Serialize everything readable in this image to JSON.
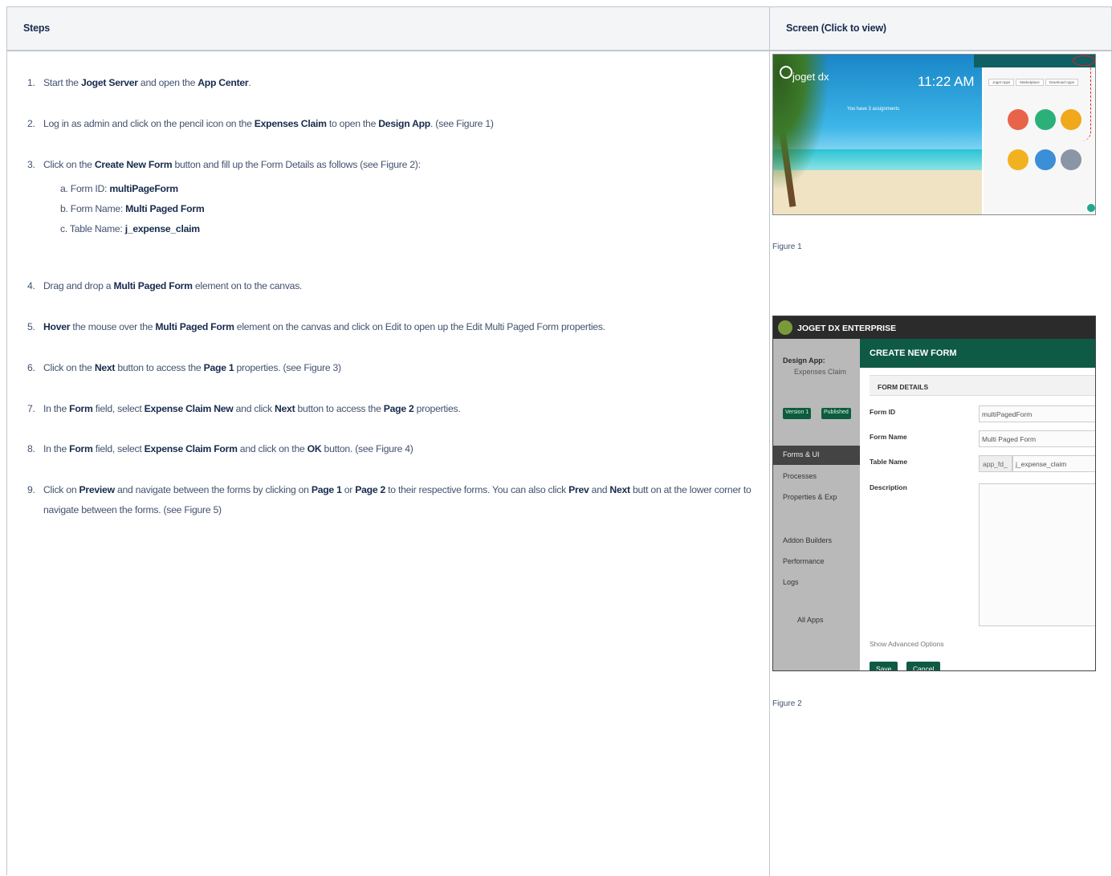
{
  "header": {
    "steps": "Steps",
    "screen": "Screen (Click to view)"
  },
  "steps": [
    {
      "num": "1.",
      "parts": [
        "Start the ",
        "Joget Server",
        " and open the ",
        "App Center",
        "."
      ]
    },
    {
      "num": "2.",
      "parts": [
        "Log in as admin and click on the pencil icon on the ",
        "Expenses Claim",
        " to open the ",
        "Design App",
        ". (see Figure 1)"
      ]
    },
    {
      "num": "3.",
      "parts": [
        "Click on the ",
        "Create New Form",
        " button and fill up the Form Details as follows (see Figure 2):"
      ]
    },
    {
      "num": "4.",
      "parts": [
        "Drag and drop a ",
        "Multi Paged Form",
        " element on to the canvas."
      ]
    },
    {
      "num": "5.",
      "parts": [
        "",
        "Hover",
        " the mouse over the ",
        "Multi Paged Form",
        " element on the canvas and click on Edit to open up the Edit Multi Paged Form properties."
      ]
    },
    {
      "num": "6.",
      "parts": [
        "Click on the ",
        "Next",
        " button to access the ",
        "Page 1",
        " properties. (see Figure 3)"
      ]
    },
    {
      "num": "7.",
      "parts": [
        "In the ",
        "Form",
        " field, select ",
        "Expense Claim New",
        " and click ",
        "Next",
        " button to access the ",
        "Page 2",
        " properties."
      ]
    },
    {
      "num": "8.",
      "parts": [
        "In the ",
        "Form",
        " field, select ",
        "Expense Claim Form",
        " and click on the ",
        "OK",
        " button. (see Figure 4)"
      ]
    },
    {
      "num": "9.",
      "parts": [
        "Click on ",
        "Preview",
        " and navigate between the forms by clicking on ",
        "Page 1",
        " or ",
        "Page 2",
        " to their respective forms. You can also click ",
        "Prev",
        " and ",
        "Next",
        " butt on at the lower corner to navigate between the forms. (see Figure 5)"
      ]
    }
  ],
  "substeps": [
    {
      "letter": "a.",
      "label": "Form ID: ",
      "value": "multiPageForm"
    },
    {
      "letter": "b.",
      "label": "Form Name: ",
      "value": "Multi Paged Form"
    },
    {
      "letter": "c.",
      "label": "Table Name: ",
      "value": "j_expense_claim"
    }
  ],
  "fig1": {
    "caption": "Figure 1",
    "logo": "joget dx",
    "clock": "11:22 AM",
    "message": "You have 3 assignments",
    "tabs": [
      "Joget Apps",
      "Marketplace",
      "Download Apps"
    ]
  },
  "fig2": {
    "caption": "Figure 2",
    "brand": "JOGET DX ENTERPRISE",
    "design_app": "Design App:",
    "app_name": "Expenses Claim",
    "version": "Version 1",
    "published": "Published",
    "nav": [
      "Forms & UI",
      "Processes",
      "Properties & Exp",
      "Addon Builders",
      "Performance",
      "Logs",
      "All Apps"
    ],
    "title": "CREATE NEW FORM",
    "section": "FORM DETAILS",
    "labels": [
      "Form ID",
      "Form Name",
      "Table Name",
      "Description"
    ],
    "values": {
      "form_id": "multiPagedForm",
      "form_name": "Multi Paged Form",
      "table_prefix": "app_fd_",
      "table_name": "j_expense_claim"
    },
    "advanced": "Show Advanced Options",
    "save": "Save",
    "cancel": "Cancel"
  },
  "colors": {
    "header_bg": "#f4f5f7",
    "border": "#c1c7d0",
    "joget_green": "#0f5a45"
  }
}
